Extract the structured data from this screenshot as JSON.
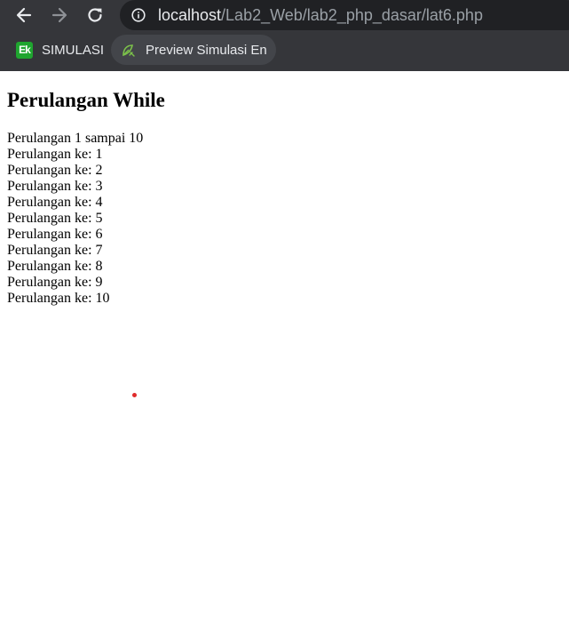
{
  "browser": {
    "url_host": "localhost",
    "url_path": "/Lab2_Web/lab2_php_dasar/lat6.php",
    "bookmarks": [
      {
        "label": "SIMULASI",
        "icon": "ek-logo-icon"
      },
      {
        "label": "Preview Simulasi En...",
        "icon": "ek-leaf-icon"
      }
    ]
  },
  "page": {
    "title": "Perulangan While",
    "intro": "Perulangan 1 sampai 10",
    "lines": [
      "Perulangan ke: 1",
      "Perulangan ke: 2",
      "Perulangan ke: 3",
      "Perulangan ke: 4",
      "Perulangan ke: 5",
      "Perulangan ke: 6",
      "Perulangan ke: 7",
      "Perulangan ke: 8",
      "Perulangan ke: 9",
      "Perulangan ke: 10"
    ]
  },
  "colors": {
    "chrome_bg": "#35363a",
    "omnibox_bg": "#202124",
    "bookmark_brand": "#1fa52f",
    "cursor_dot": "#e02b2b"
  }
}
